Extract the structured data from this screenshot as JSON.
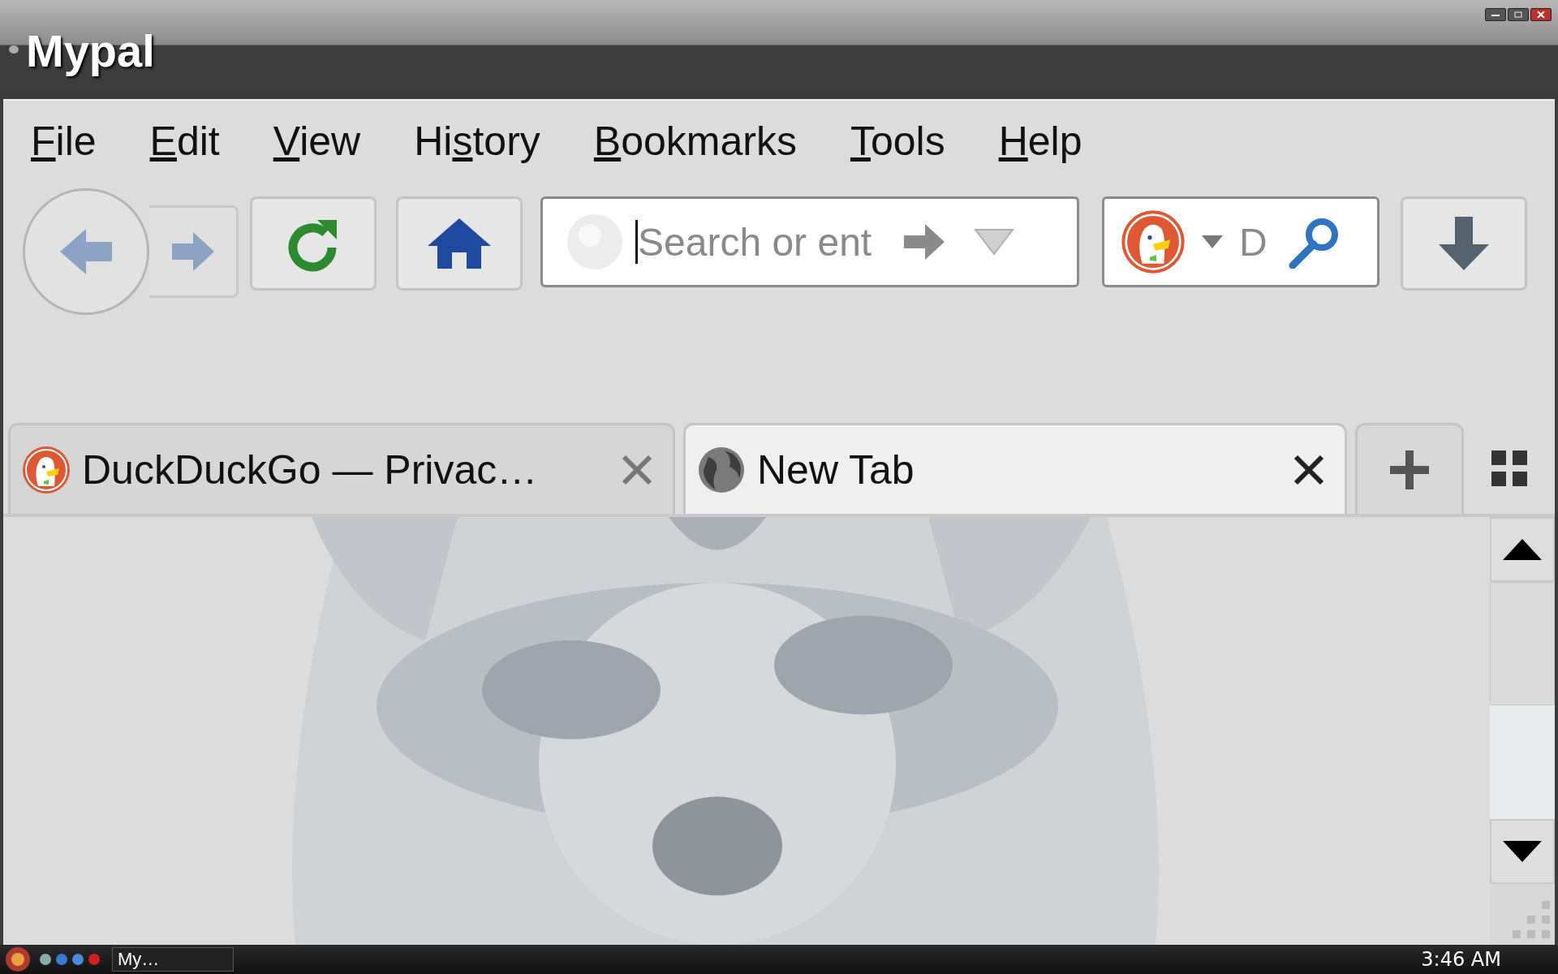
{
  "window": {
    "title": "Mypal"
  },
  "menu": [
    {
      "key": "F",
      "after": "ile"
    },
    {
      "key": "E",
      "after": "dit"
    },
    {
      "key": "V",
      "after": "iew"
    },
    {
      "before": "Hi",
      "key": "s",
      "after": "tory"
    },
    {
      "key": "B",
      "after": "ookmarks"
    },
    {
      "key": "T",
      "after": "ools"
    },
    {
      "key": "H",
      "after": "elp"
    }
  ],
  "url_bar": {
    "placeholder": "Search or ent"
  },
  "search_bar": {
    "placeholder": "D"
  },
  "tabs": [
    {
      "label": "DuckDuckGo — Privac…",
      "kind": "site",
      "selected": false
    },
    {
      "label": "New Tab",
      "kind": "blank",
      "selected": true
    }
  ],
  "taskbar": {
    "task": "My…",
    "clock": "3:46 AM"
  }
}
